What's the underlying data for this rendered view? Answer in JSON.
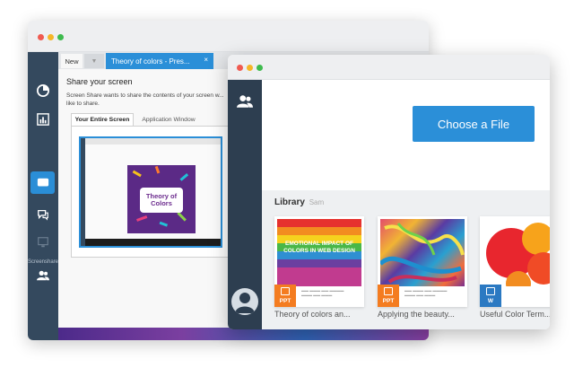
{
  "back_window": {
    "sidebar": {
      "items": [
        {
          "icon": "pie-chart-icon"
        },
        {
          "icon": "bar-chart-icon"
        },
        {
          "icon": "screen-icon"
        },
        {
          "icon": "chat-icon"
        },
        {
          "icon": "monitor-icon"
        },
        {
          "icon": "users-icon"
        }
      ],
      "screenshare_label": "Screenshare"
    },
    "tabs": {
      "new_label": "New",
      "dropdown_icon": "chevron-down-icon",
      "active_label": "Theory of colors - Pres...",
      "close_icon": "×"
    },
    "dialog": {
      "title": "Share your screen",
      "description": "Screen Share wants to share the contents of your screen w... like to share.",
      "tabs": [
        "Your Entire Screen",
        "Application Window"
      ],
      "thumbnail_card_text": "Theory of Colors"
    }
  },
  "front_window": {
    "sidebar_icons": [
      "users-icon",
      "avatar-icon",
      "logout-icon"
    ],
    "choose_button": "Choose a File",
    "library": {
      "title": "Library",
      "subtitle": "Sam",
      "cards": [
        {
          "title": "Theory of colors an...",
          "badge": "PPT",
          "badge_color": "#f47c20",
          "image_text": "EMOTIONAL IMPACT OF COLORS IN WEB DESIGN"
        },
        {
          "title": "Applying the beauty...",
          "badge": "PPT",
          "badge_color": "#f47c20"
        },
        {
          "title": "Useful Color Term...",
          "badge": "W",
          "badge_color": "#2b79c2"
        }
      ]
    }
  },
  "colors": {
    "accent": "#2b8fd8",
    "sidebar": "#34495e",
    "ppt": "#f47c20",
    "word": "#2b79c2"
  }
}
